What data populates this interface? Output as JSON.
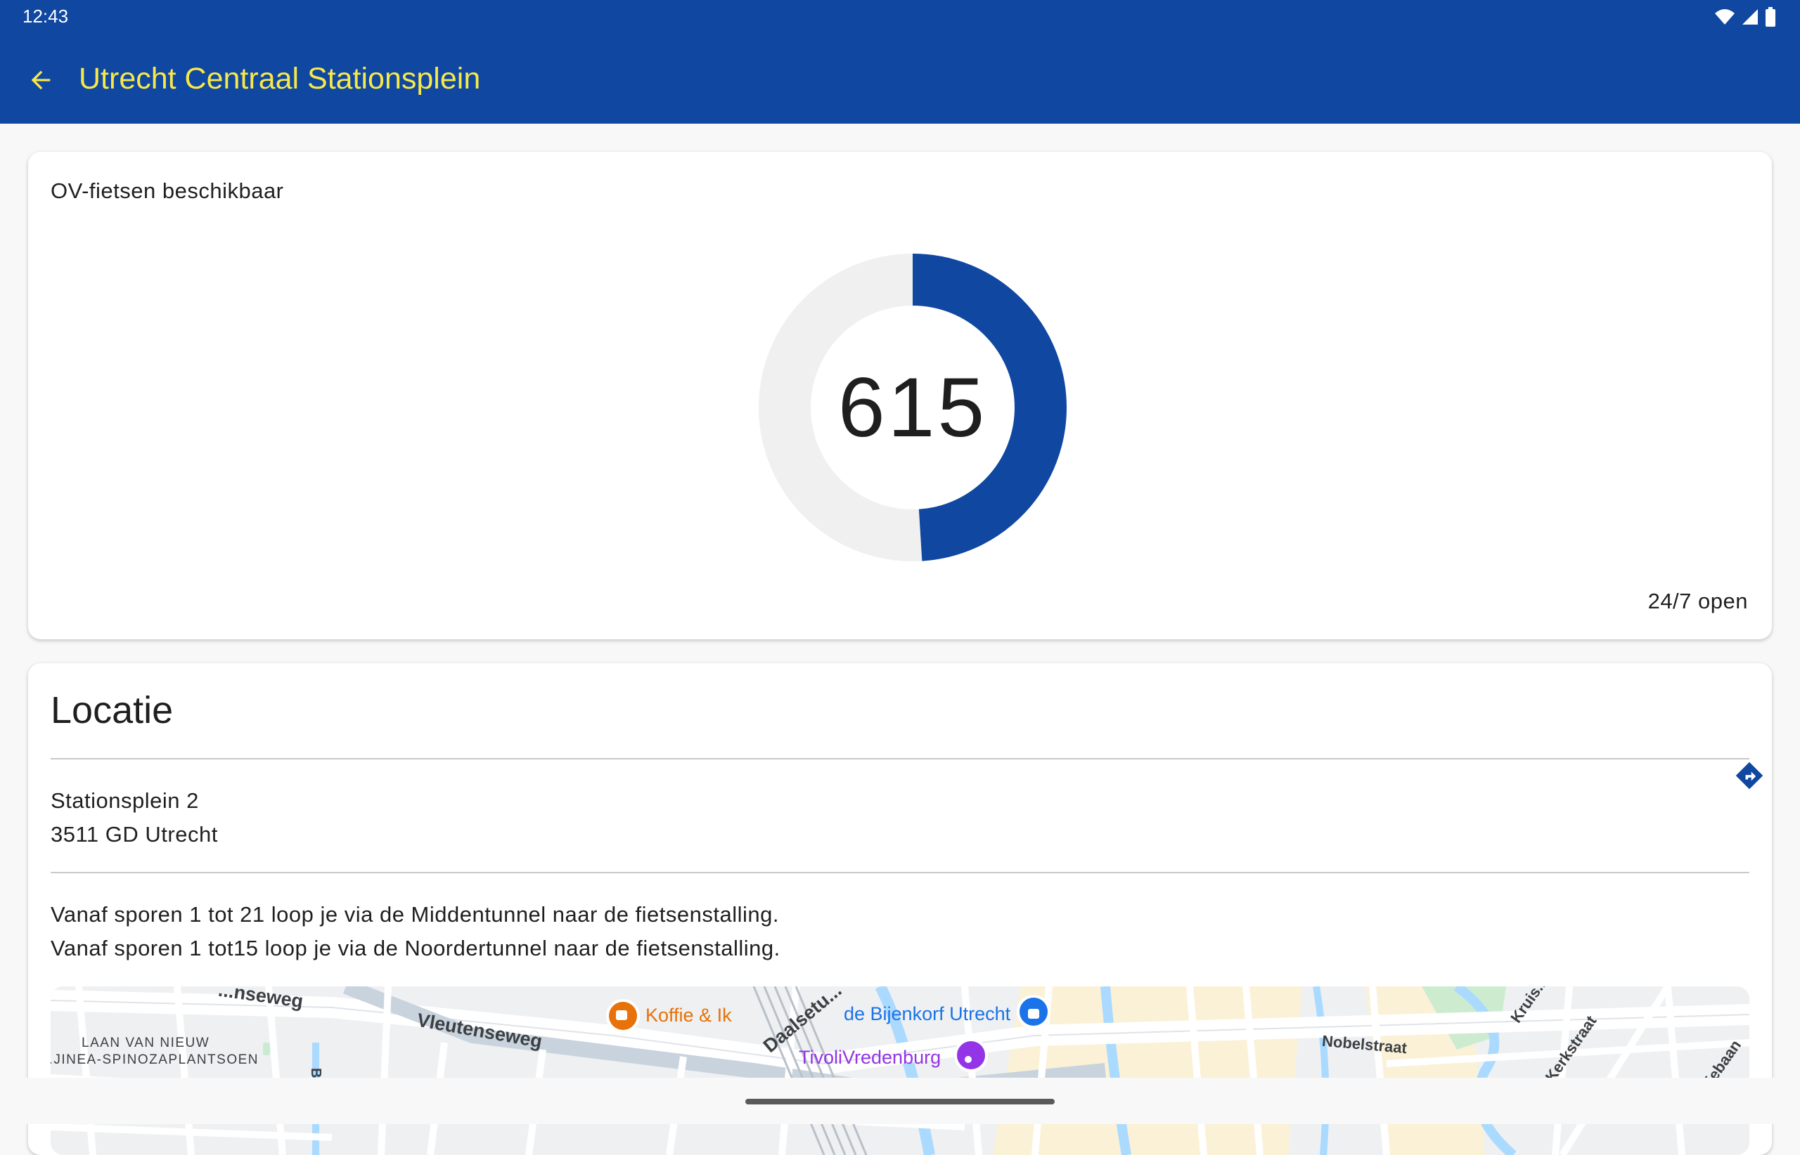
{
  "status_bar": {
    "time": "12:43",
    "icons": [
      "wifi-icon",
      "signal-icon",
      "battery-icon"
    ]
  },
  "app_bar": {
    "title": "Utrecht Centraal Stationsplein",
    "back_icon": "arrow-left-icon"
  },
  "availability": {
    "label": "OV-fietsen beschikbaar",
    "count": "615",
    "fill_fraction": 0.49,
    "hours": "24/7 open"
  },
  "location": {
    "heading": "Locatie",
    "address_line1": "Stationsplein 2",
    "address_line2": "3511 GD Utrecht",
    "directions_icon": "directions-icon",
    "description_line1": "Vanaf sporen 1 tot 21 loop je via de Middentunnel naar de fietsenstalling.",
    "description_line2": "Vanaf sporen 1 tot15 loop je via de Noordertunnel naar de fietsenstalling."
  },
  "map": {
    "labels": {
      "street1": "...nseweg",
      "street2": "Vleutenseweg",
      "poi_coffee": "Koffie & Ik",
      "street3": "Daalsetu...",
      "poi_store": "de Bijenkorf Utrecht",
      "poi_venue": "TivoliVredenburg",
      "street4": "Nobelstraat",
      "street5": "Kerkstraat",
      "street6": "Kruis...",
      "street7": "...iebaan",
      "park_line1": "LAAN VAN NIEUW",
      "park_line2": "...JINEA-SPINOZAPLANTSOEN",
      "street8": "Billit..."
    }
  },
  "colors": {
    "primary": "#0f47a1",
    "title_yellow": "#f7e84a",
    "donut_track": "#f0f0f0",
    "poi_orange": "#e8710a",
    "poi_blue": "#1a73e8",
    "poi_purple": "#9334e6"
  }
}
